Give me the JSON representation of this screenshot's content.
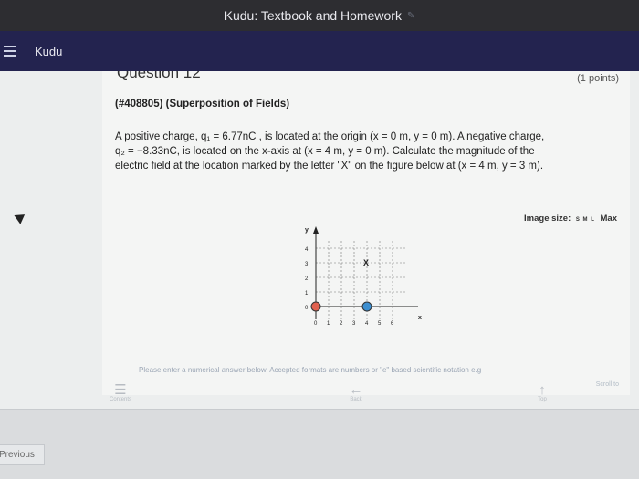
{
  "window": {
    "title": "Kudu: Textbook and Homework"
  },
  "appbar": {
    "app_name": "Kudu"
  },
  "question": {
    "heading": "Question 12",
    "points": "(1 points)",
    "problem_id": "(#408805)   (Superposition of Fields)",
    "line1": "A positive charge, q₁ = 6.77nC , is located at the origin (x = 0 m, y = 0 m). A negative charge,",
    "line2": "q₂ = −8.33nC, is located on the x-axis at (x = 4 m, y = 0 m). Calculate the magnitude of the",
    "line3": "electric field at the location marked by the letter \"X\" on the figure below at (x = 4 m, y = 3 m)."
  },
  "image_size": {
    "label": "Image size:",
    "small": "S M L",
    "max": "Max"
  },
  "figure": {
    "y_axis_label": "y",
    "x_axis_label": "x",
    "y_ticks": [
      "0",
      "1",
      "2",
      "3",
      "4"
    ],
    "x_ticks": [
      "0",
      "1",
      "2",
      "3",
      "4",
      "5",
      "6"
    ],
    "marker_label": "X",
    "q1_color": "#e0614f",
    "q2_color": "#3d8fd0"
  },
  "hint": "Please enter a numerical answer below. Accepted formats are numbers or \"e\" based scientific notation e.g",
  "scroll_to": "Scroll to",
  "nav": {
    "contents": "Contents",
    "back": "Back",
    "top": "Top"
  },
  "footer": {
    "previous": "Previous"
  }
}
